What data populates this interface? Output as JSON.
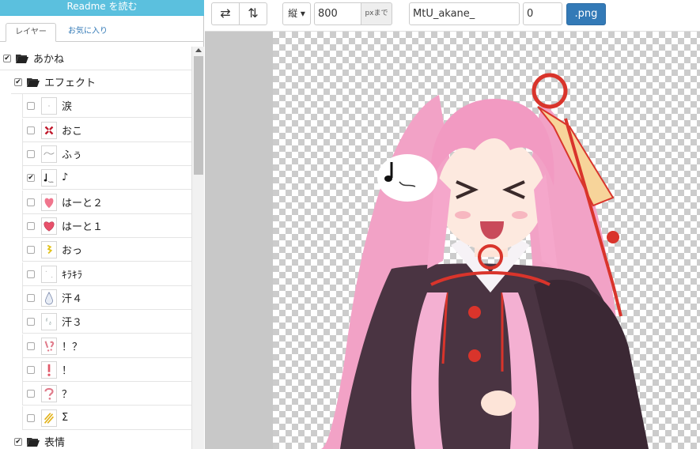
{
  "readme": {
    "label": "Readme を読む"
  },
  "tabs": [
    {
      "label": "レイヤー"
    },
    {
      "label": "お気に入り"
    }
  ],
  "layers": [
    {
      "label": "あかね",
      "checked": true,
      "type": "folder"
    },
    {
      "label": "エフェクト",
      "checked": true,
      "type": "folder"
    },
    {
      "label": "涙",
      "checked": false,
      "type": "layer"
    },
    {
      "label": "おこ",
      "checked": false,
      "type": "layer"
    },
    {
      "label": "ふぅ",
      "checked": false,
      "type": "layer"
    },
    {
      "label": "♪",
      "checked": true,
      "type": "layer"
    },
    {
      "label": "はーと２",
      "checked": false,
      "type": "layer"
    },
    {
      "label": "はーと１",
      "checked": false,
      "type": "layer"
    },
    {
      "label": "おっ",
      "checked": false,
      "type": "layer"
    },
    {
      "label": "ｷﾗｷﾗ",
      "checked": false,
      "type": "layer"
    },
    {
      "label": "汗４",
      "checked": false,
      "type": "layer"
    },
    {
      "label": "汗３",
      "checked": false,
      "type": "layer"
    },
    {
      "label": "！？",
      "checked": false,
      "type": "layer"
    },
    {
      "label": "！",
      "checked": false,
      "type": "layer"
    },
    {
      "label": "？",
      "checked": false,
      "type": "layer"
    },
    {
      "label": "Σ",
      "checked": false,
      "type": "layer"
    },
    {
      "label": "表情",
      "checked": true,
      "type": "folder"
    }
  ],
  "toolbar": {
    "swap_icon": "⇄",
    "flip_icon": "⇅",
    "direction": "縦 ▾",
    "size_value": "800",
    "size_unit": "pxまで",
    "filename": "MtU_akane_",
    "number": "0",
    "export_label": ".png"
  },
  "colors": {
    "readme_bg": "#5bc0de",
    "primary": "#337ab7",
    "hair": "#f4a6c8",
    "kimono": "#4a3442",
    "ribbon": "#d9342b"
  }
}
